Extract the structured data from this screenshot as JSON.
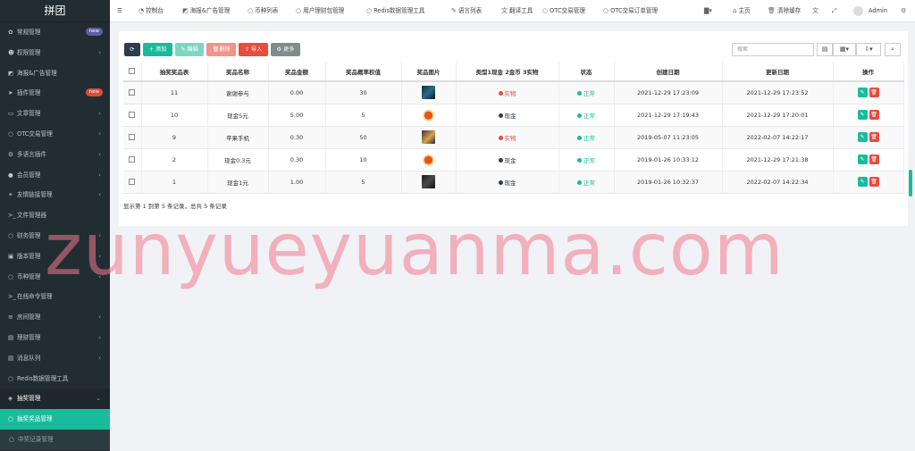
{
  "app": {
    "title": "拼团"
  },
  "sidebar": {
    "items": [
      {
        "label": "常规管理",
        "icon": "gear-icon",
        "badge": "new",
        "badge_color": "#605ca8"
      },
      {
        "label": "权限管理",
        "icon": "users-icon",
        "chevron": "‹"
      },
      {
        "label": "海报&广告管理",
        "icon": "image-icon"
      },
      {
        "label": "插件管理",
        "icon": "rocket-icon",
        "badge": "new",
        "badge_color": "#dd4b39"
      },
      {
        "label": "文章管理",
        "icon": "file-icon",
        "chevron": "‹"
      },
      {
        "label": "OTC交易管理",
        "icon": "circle-icon",
        "chevron": "‹"
      },
      {
        "label": "多语言插件",
        "icon": "settings-icon",
        "chevron": "‹"
      },
      {
        "label": "会员管理",
        "icon": "user-icon",
        "chevron": "‹"
      },
      {
        "label": "友情链接管理",
        "icon": "link-icon",
        "chevron": "‹"
      },
      {
        "label": "文件管理器",
        "icon": "terminal-icon"
      },
      {
        "label": "财务管理",
        "icon": "circle-icon",
        "chevron": "‹"
      },
      {
        "label": "版本管理",
        "icon": "box-icon",
        "chevron": "‹"
      },
      {
        "label": "币种管理",
        "icon": "circle-icon",
        "chevron": "‹"
      },
      {
        "label": "在线命令管理",
        "icon": "terminal-icon"
      },
      {
        "label": "房间管理",
        "icon": "list-icon",
        "chevron": "‹"
      },
      {
        "label": "理财管理",
        "icon": "table-icon",
        "chevron": "‹"
      },
      {
        "label": "消息队列",
        "icon": "table-icon",
        "chevron": "‹"
      },
      {
        "label": "Redis数据管理工具",
        "icon": "circle-icon"
      },
      {
        "label": "抽奖管理",
        "icon": "cube-icon",
        "chevron": "⌄",
        "state": "open"
      },
      {
        "label": "抽奖奖品管理",
        "icon": "circle-icon",
        "state": "active"
      },
      {
        "label": "中奖记录管理",
        "icon": "circle-icon",
        "state": "sub"
      }
    ]
  },
  "topbar": {
    "menu_icon": "☰",
    "tabs": [
      {
        "label": "控制台",
        "icon": "dashboard-icon"
      },
      {
        "label": "海报&广告管理",
        "icon": "image-icon"
      },
      {
        "label": "币种列表",
        "icon": "circle-icon"
      },
      {
        "label": "用户理财包管理",
        "icon": "circle-icon"
      },
      {
        "label": "Redis数据管理工具",
        "icon": "circle-icon"
      },
      {
        "label": "语言列表",
        "icon": "edit-icon"
      },
      {
        "label": "翻译工具",
        "icon": "translate-icon"
      },
      {
        "label": "OTC交易管理",
        "icon": "circle-icon"
      },
      {
        "label": "OTC交易订单管理",
        "icon": "circle-icon"
      }
    ],
    "home_label": "主页",
    "clear_cache_label": "清除缓存",
    "user_name": "Admin"
  },
  "toolbar": {
    "add_label": "添加",
    "edit_label": "编辑",
    "delete_label": "删除",
    "import_label": "导入",
    "more_label": "更多",
    "search_placeholder": "搜索"
  },
  "colors": {
    "accent": "#18bc9c",
    "sidebar": "#222d32",
    "danger": "#e74c3c",
    "primary": "#2c3e50",
    "info": "#3498db"
  },
  "table": {
    "headers": [
      "抽奖奖品表",
      "奖品名称",
      "奖品金额",
      "奖品概率权值",
      "奖品图片",
      "类型1现金 2金币 3实物",
      "状态",
      "创建日期",
      "更新日期",
      "操作"
    ],
    "rows": [
      {
        "id": "11",
        "name": "谢谢参与",
        "amount": "0.00",
        "weight": "30",
        "type": "实物",
        "type_color": "#e74c3c",
        "status": "正常",
        "created": "2021-12-29 17:23:09",
        "updated": "2021-12-29 17:23:52"
      },
      {
        "id": "10",
        "name": "现金5元",
        "amount": "5.00",
        "weight": "5",
        "type": "现金",
        "type_color": "#2c3e50",
        "status": "正常",
        "created": "2021-12-29 17:19:43",
        "updated": "2021-12-29 17:20:01"
      },
      {
        "id": "9",
        "name": "苹果手机",
        "amount": "0.30",
        "weight": "50",
        "type": "实物",
        "type_color": "#e74c3c",
        "status": "正常",
        "created": "2019-05-07 11:23:05",
        "updated": "2022-02-07 14:22:17"
      },
      {
        "id": "2",
        "name": "现金0.3元",
        "amount": "0.30",
        "weight": "10",
        "type": "现金",
        "type_color": "#2c3e50",
        "status": "正常",
        "created": "2019-01-26 10:33:12",
        "updated": "2021-12-29 17:21:38"
      },
      {
        "id": "1",
        "name": "现金1元",
        "amount": "1.00",
        "weight": "5",
        "type": "现金",
        "type_color": "#2c3e50",
        "status": "正常",
        "created": "2019-01-26 10:32:37",
        "updated": "2022-02-07 14:22:34"
      }
    ],
    "summary": "显示第 1 到第 5 条记录，总共 5 条记录"
  },
  "watermark": "zunyueyuanma.com"
}
